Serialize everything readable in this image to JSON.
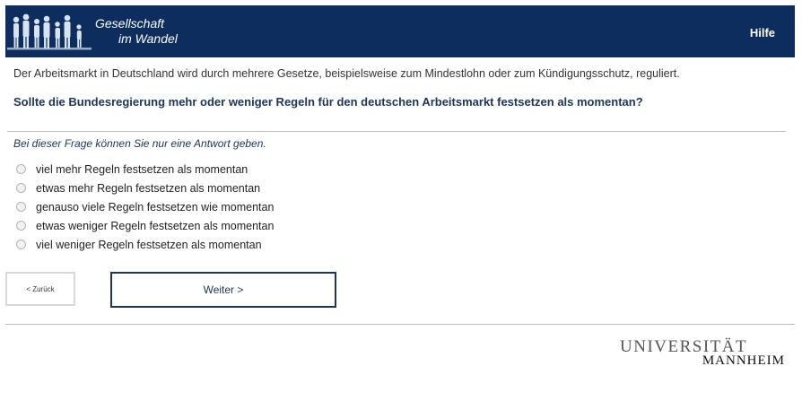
{
  "header": {
    "logo_line1": "Gesellschaft",
    "logo_line2": "im Wandel",
    "help_label": "Hilfe",
    "background_color": "#0c2d5e"
  },
  "intro_text": "Der Arbeitsmarkt in Deutschland wird durch mehrere Gesetze, beispielsweise zum Mindestlohn oder zum Kündigungsschutz, reguliert.",
  "question_text": "Sollte die Bundesregierung mehr oder weniger Regeln für den deutschen Arbeitsmarkt festsetzen als momentan?",
  "hint_text": "Bei dieser Frage können Sie nur eine Antwort geben.",
  "options": [
    {
      "label": "viel mehr Regeln festsetzen als momentan"
    },
    {
      "label": "etwas mehr Regeln festsetzen als momentan"
    },
    {
      "label": "genauso viele Regeln festsetzen wie momentan"
    },
    {
      "label": "etwas weniger Regeln festsetzen als momentan"
    },
    {
      "label": "viel weniger Regeln festsetzen als momentan"
    }
  ],
  "buttons": {
    "back_label": "< Zurück",
    "next_label": "Weiter >"
  },
  "footer_logo": {
    "line1": "UNIVERSITÄT",
    "line2": "MANNHEIM"
  }
}
